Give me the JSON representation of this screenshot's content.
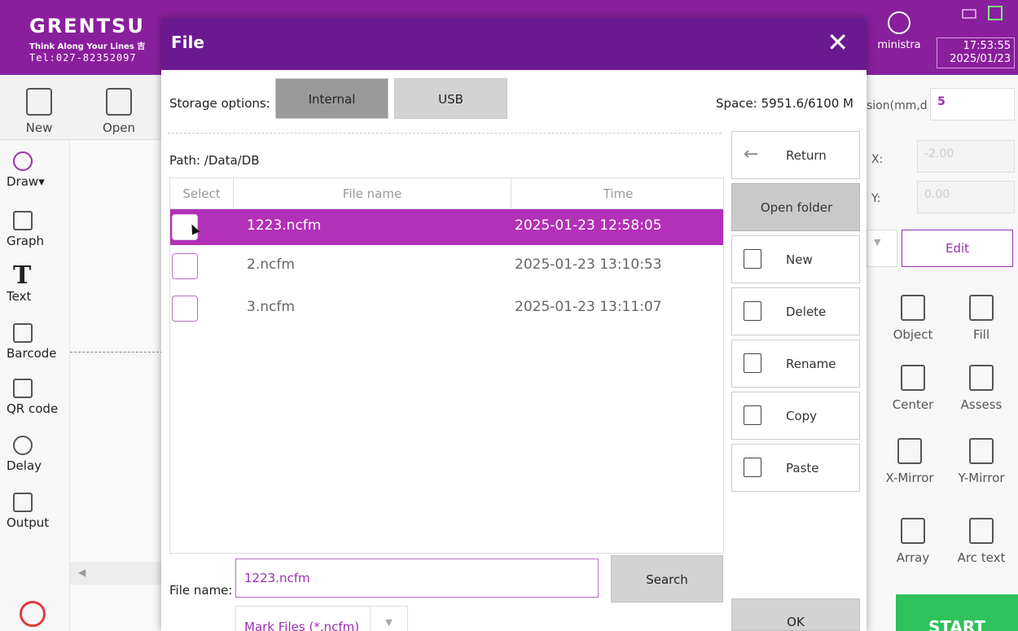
{
  "brand": {
    "logo": "GRENTSU",
    "slogan": "Think Along Your Lines 吉",
    "tel": "Tel:027-82352097"
  },
  "user": {
    "label": "ministra"
  },
  "clock": {
    "time": "17:53:55",
    "date": "2025/01/23"
  },
  "toolbar": {
    "new_label": "New",
    "open_label": "Open"
  },
  "left_tools": [
    {
      "label": "Draw"
    },
    {
      "label": "Graph"
    },
    {
      "label": "Text"
    },
    {
      "label": "Barcode"
    },
    {
      "label": "QR code"
    },
    {
      "label": "Delay"
    },
    {
      "label": "Output"
    }
  ],
  "right_panel": {
    "precision_label": "sion(mm,d",
    "precision_value": "5",
    "x_label": "X:",
    "x_value": "-2.00",
    "y_label": "Y:",
    "y_value": "0.00",
    "edit_label": "Edit",
    "tools": [
      {
        "label": "Object"
      },
      {
        "label": "Fill"
      },
      {
        "label": "Center"
      },
      {
        "label": "Assess"
      },
      {
        "label": "X-Mirror"
      },
      {
        "label": "Y-Mirror"
      },
      {
        "label": "Array"
      },
      {
        "label": "Arc text"
      }
    ],
    "start_label": "START"
  },
  "dialog": {
    "title": "File",
    "close_glyph": "✕",
    "storage_label": "Storage options:",
    "storage_internal": "Internal",
    "storage_usb": "USB",
    "space": "Space: 5951.6/6100 M",
    "path": "Path:  /Data/DB",
    "columns": {
      "select": "Select",
      "name": "File name",
      "time": "Time"
    },
    "files": [
      {
        "name": "1223.ncfm",
        "time": "2025-01-23  12:58:05",
        "selected": true
      },
      {
        "name": "2.ncfm",
        "time": "2025-01-23  13:10:53",
        "selected": false
      },
      {
        "name": "3.ncfm",
        "time": "2025-01-23  13:11:07",
        "selected": false
      }
    ],
    "buttons": {
      "return": "Return",
      "open_folder": "Open folder",
      "new": "New",
      "delete": "Delete",
      "rename": "Rename",
      "copy": "Copy",
      "paste": "Paste",
      "search": "Search",
      "ok": "OK"
    },
    "filename_label": "File name:",
    "filename_value": "1223.ncfm",
    "filter_value": "Mark Files (*.ncfm)"
  }
}
